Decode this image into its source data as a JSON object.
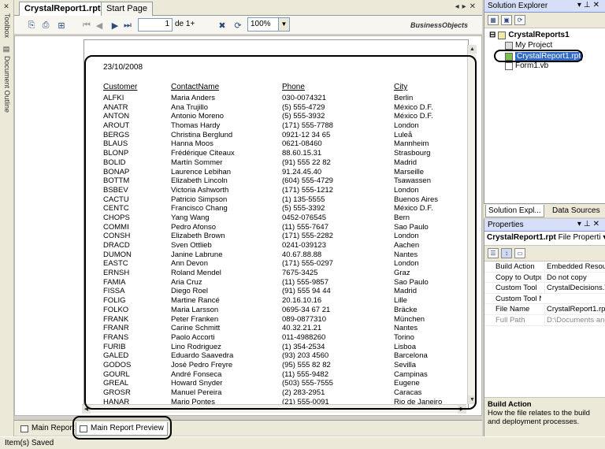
{
  "left_strip": {
    "toolbox": "Toolbox",
    "document_outline": "Document Outline"
  },
  "doc_tabs": [
    {
      "label": "CrystalReport1.rpt*"
    },
    {
      "label": "Start Page"
    }
  ],
  "report_toolbar": {
    "page_current": "1",
    "page_of": "de 1+",
    "zoom": "100%",
    "brand": "BusinessObjects"
  },
  "report": {
    "date": "23/10/2008",
    "headers": {
      "customer": "Customer",
      "contact": "ContactName",
      "phone": "Phone",
      "city": "City"
    },
    "rows": [
      [
        "ALFKI",
        "Maria Anders",
        "030-0074321",
        "Berlin"
      ],
      [
        "ANATR",
        "Ana Trujillo",
        "(5) 555-4729",
        "México D.F."
      ],
      [
        "ANTON",
        "Antonio Moreno",
        "(5) 555-3932",
        "México D.F."
      ],
      [
        "AROUT",
        "Thomas Hardy",
        "(171) 555-7788",
        "London"
      ],
      [
        "BERGS",
        "Christina Berglund",
        "0921-12 34 65",
        "Luleå"
      ],
      [
        "BLAUS",
        "Hanna Moos",
        "0621-08460",
        "Mannheim"
      ],
      [
        "BLONP",
        "Frédérique Citeaux",
        "88.60.15.31",
        "Strasbourg"
      ],
      [
        "BOLID",
        "Martín Sommer",
        "(91) 555 22 82",
        "Madrid"
      ],
      [
        "BONAP",
        "Laurence Lebihan",
        "91.24.45.40",
        "Marseille"
      ],
      [
        "BOTTM",
        "Elizabeth Lincoln",
        "(604) 555-4729",
        "Tsawassen"
      ],
      [
        "BSBEV",
        "Victoria Ashworth",
        "(171) 555-1212",
        "London"
      ],
      [
        "CACTU",
        "Patricio Simpson",
        "(1) 135-5555",
        "Buenos Aires"
      ],
      [
        "CENTC",
        "Francisco Chang",
        "(5) 555-3392",
        "México D.F."
      ],
      [
        "CHOPS",
        "Yang Wang",
        "0452-076545",
        "Bern"
      ],
      [
        "COMMI",
        "Pedro Afonso",
        "(11) 555-7647",
        "Sao Paulo"
      ],
      [
        "CONSH",
        "Elizabeth Brown",
        "(171) 555-2282",
        "London"
      ],
      [
        "DRACD",
        "Sven Ottlieb",
        "0241-039123",
        "Aachen"
      ],
      [
        "DUMON",
        "Janine Labrune",
        "40.67.88.88",
        "Nantes"
      ],
      [
        "EASTC",
        "Ann Devon",
        "(171) 555-0297",
        "London"
      ],
      [
        "ERNSH",
        "Roland Mendel",
        "7675-3425",
        "Graz"
      ],
      [
        "FAMIA",
        "Aria Cruz",
        "(11) 555-9857",
        "Sao Paulo"
      ],
      [
        "FISSA",
        "Diego Roel",
        "(91) 555 94 44",
        "Madrid"
      ],
      [
        "FOLIG",
        "Martine Rancé",
        "20.16.10.16",
        "Lille"
      ],
      [
        "FOLKO",
        "Maria Larsson",
        "0695-34 67 21",
        "Bräcke"
      ],
      [
        "FRANK",
        "Peter Franken",
        "089-0877310",
        "München"
      ],
      [
        "FRANR",
        "Carine Schmitt",
        "40.32.21.21",
        "Nantes"
      ],
      [
        "FRANS",
        "Paolo Accorti",
        "011-4988260",
        "Torino"
      ],
      [
        "FURIB",
        "Lino Rodriguez",
        "(1) 354-2534",
        "Lisboa"
      ],
      [
        "GALED",
        "Eduardo Saavedra",
        "(93) 203 4560",
        "Barcelona"
      ],
      [
        "GODOS",
        "José Pedro Freyre",
        "(95) 555 82 82",
        "Sevilla"
      ],
      [
        "GOURL",
        "André Fonseca",
        "(11) 555-9482",
        "Campinas"
      ],
      [
        "GREAL",
        "Howard Snyder",
        "(503) 555-7555",
        "Eugene"
      ],
      [
        "GROSR",
        "Manuel Pereira",
        "(2) 283-2951",
        "Caracas"
      ],
      [
        "HANAR",
        "Mario Pontes",
        "(21) 555-0091",
        "Rio de Janeiro"
      ]
    ]
  },
  "bottom_tabs": [
    {
      "label": "Main Report"
    },
    {
      "label": "Main Report Preview"
    }
  ],
  "status": "Item(s) Saved",
  "solution_explorer": {
    "title": "Solution Explorer",
    "items": [
      {
        "label": "CrystalReports1"
      },
      {
        "label": "My Project"
      },
      {
        "label": "CrystalReport1.rpt"
      },
      {
        "label": "Form1.vb"
      }
    ],
    "tabs": [
      {
        "label": "Solution Expl..."
      },
      {
        "label": "Data Sources"
      }
    ]
  },
  "properties": {
    "title": "Properties",
    "object": "CrystalReport1.rpt",
    "object_type": "File Properti",
    "rows": [
      {
        "name": "Build Action",
        "value": "Embedded Resource"
      },
      {
        "name": "Copy to Output",
        "value": "Do not copy"
      },
      {
        "name": "Custom Tool",
        "value": "CrystalDecisions.VSDesigner"
      },
      {
        "name": "Custom Tool Na",
        "value": ""
      },
      {
        "name": "File Name",
        "value": "CrystalReport1.rpt"
      },
      {
        "name": "Full Path",
        "value": "D:\\Documents and S"
      }
    ],
    "desc_title": "Build Action",
    "desc_text": "How the file relates to the build and deployment processes."
  }
}
